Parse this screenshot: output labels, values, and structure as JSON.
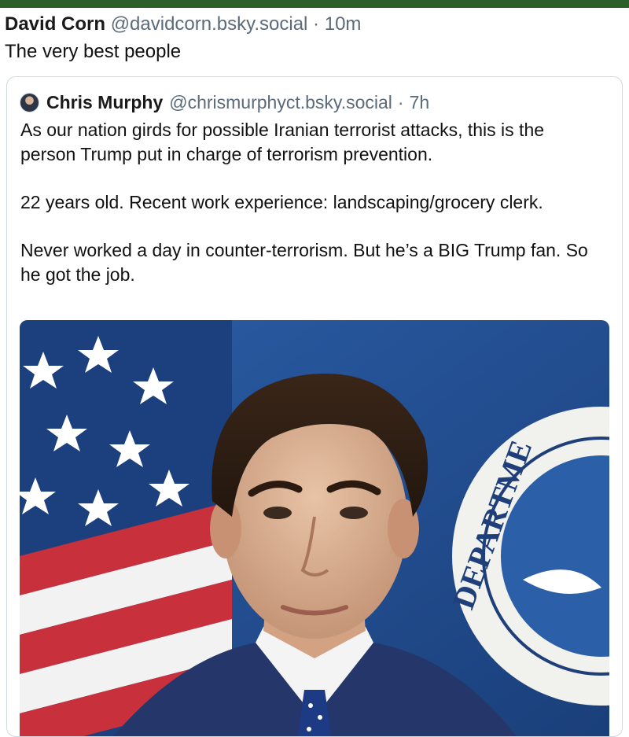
{
  "post": {
    "author_name": "David Corn",
    "author_handle": "@davidcorn.bsky.social",
    "separator": "·",
    "time": "10m",
    "text": "The very best people"
  },
  "quoted_post": {
    "author_name": "Chris Murphy",
    "author_handle": "@chrismurphyct.bsky.social",
    "separator": "·",
    "time": "7h",
    "paragraphs": [
      "As our nation girds for possible Iranian terrorist attacks, this is the person Trump put in charge of terrorism prevention.",
      "22 years old. Recent work experience: landscaping/grocery clerk.",
      "Never worked a day in counter-terrorism. But he’s a BIG Trump fan. So he got the job."
    ],
    "image": {
      "seal_text": "DEPARTME"
    }
  },
  "colors": {
    "top_bar": "#2e5e2a",
    "muted_text": "#5b6b7a",
    "border": "#cfd9e2"
  }
}
